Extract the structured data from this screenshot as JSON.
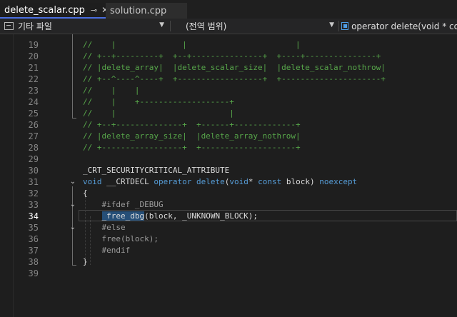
{
  "tabs": [
    {
      "label": "delete_scalar.cpp",
      "pin_icon": "pin-icon",
      "close_icon": "close-icon"
    },
    {
      "label": "solution.cpp"
    }
  ],
  "nav": {
    "project": "기타 파일",
    "scope": "(전역 범위)",
    "member": "operator delete(void * cons"
  },
  "editor": {
    "current_line": 34,
    "lines": [
      {
        "n": "19",
        "tokens": [
          {
            "t": "//    |              |                       |",
            "c": "c"
          }
        ]
      },
      {
        "n": "20",
        "tokens": [
          {
            "t": "// +--+---------+  +--+---------------+  +----+---------------+",
            "c": "c"
          }
        ]
      },
      {
        "n": "21",
        "tokens": [
          {
            "t": "// |delete_array|  |delete_scalar_size|  |delete_scalar_nothrow|",
            "c": "c"
          }
        ]
      },
      {
        "n": "22",
        "tokens": [
          {
            "t": "// +--^----^----+  +------------------+  +---------------------+",
            "c": "c"
          }
        ]
      },
      {
        "n": "23",
        "tokens": [
          {
            "t": "//    |    |",
            "c": "c"
          }
        ]
      },
      {
        "n": "24",
        "tokens": [
          {
            "t": "//    |    +-------------------+",
            "c": "c"
          }
        ]
      },
      {
        "n": "25",
        "tokens": [
          {
            "t": "//    |                        |",
            "c": "c"
          }
        ]
      },
      {
        "n": "26",
        "tokens": [
          {
            "t": "// +--+--------------+  +------+-------------+",
            "c": "c"
          }
        ]
      },
      {
        "n": "27",
        "tokens": [
          {
            "t": "// |delete_array_size|  |delete_array_nothrow|",
            "c": "c"
          }
        ]
      },
      {
        "n": "28",
        "tokens": [
          {
            "t": "// +-----------------+  +--------------------+",
            "c": "c"
          }
        ]
      },
      {
        "n": "29",
        "tokens": []
      },
      {
        "n": "30",
        "tokens": [
          {
            "t": "_CRT_SECURITYCRITICAL_ATTRIBUTE",
            "c": "id"
          }
        ]
      },
      {
        "n": "31",
        "tokens": [
          {
            "t": "void",
            "c": "k"
          },
          {
            "t": " __CRTDECL ",
            "c": "id"
          },
          {
            "t": "operator",
            "c": "k"
          },
          {
            "t": " ",
            "c": "id"
          },
          {
            "t": "delete",
            "c": "k"
          },
          {
            "t": "(",
            "c": "id"
          },
          {
            "t": "void",
            "c": "k"
          },
          {
            "t": "* ",
            "c": "id"
          },
          {
            "t": "const",
            "c": "k"
          },
          {
            "t": " block) ",
            "c": "id"
          },
          {
            "t": "noexcept",
            "c": "k"
          }
        ]
      },
      {
        "n": "32",
        "tokens": [
          {
            "t": "{",
            "c": "id"
          }
        ]
      },
      {
        "n": "33",
        "tokens": [
          {
            "t": "    #ifdef _DEBUG",
            "c": "pp"
          }
        ]
      },
      {
        "n": "34",
        "tokens": [
          {
            "t": "    ",
            "c": "id"
          },
          {
            "t": "_free_dbg",
            "c": "sel"
          },
          {
            "t": "(block, _UNKNOWN_BLOCK);",
            "c": "id"
          }
        ]
      },
      {
        "n": "35",
        "tokens": [
          {
            "t": "    #else",
            "c": "pp"
          }
        ]
      },
      {
        "n": "36",
        "tokens": [
          {
            "t": "    free(block);",
            "c": "pp"
          }
        ]
      },
      {
        "n": "37",
        "tokens": [
          {
            "t": "    #endif",
            "c": "pp"
          }
        ]
      },
      {
        "n": "38",
        "tokens": [
          {
            "t": "}",
            "c": "id"
          }
        ]
      },
      {
        "n": "39",
        "tokens": []
      }
    ],
    "folds": [
      "31",
      "33",
      "35"
    ]
  }
}
